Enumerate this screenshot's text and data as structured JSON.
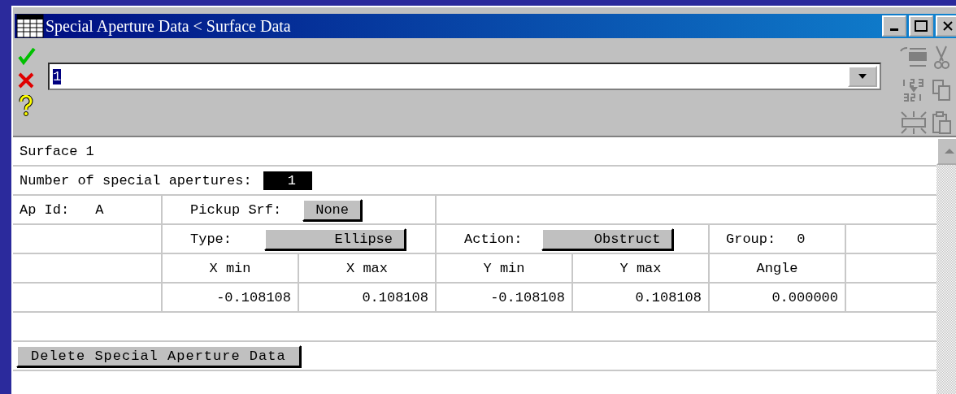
{
  "window": {
    "title": "Special Aperture Data < Surface Data"
  },
  "toolbar": {
    "field": {
      "value": "1"
    }
  },
  "surface": "Surface 1",
  "apertures": {
    "label": "Number of special apertures:",
    "value": "1"
  },
  "aperture": {
    "id_label": "Ap Id:",
    "id": "A",
    "pickup_label": "Pickup Srf:",
    "pickup": "None",
    "type_label": "Type:",
    "type": "Ellipse",
    "action_label": "Action:",
    "action": "Obstruct",
    "group_label": "Group:",
    "group": "0"
  },
  "table": {
    "columns": [
      "X min",
      "X max",
      "Y min",
      "Y max",
      "Angle"
    ],
    "rows": [
      [
        "-0.108108",
        "0.108108",
        "-0.108108",
        "0.108108",
        "0.000000"
      ]
    ]
  },
  "buttons": [
    {
      "label": "Delete Special Aperture Data"
    }
  ]
}
